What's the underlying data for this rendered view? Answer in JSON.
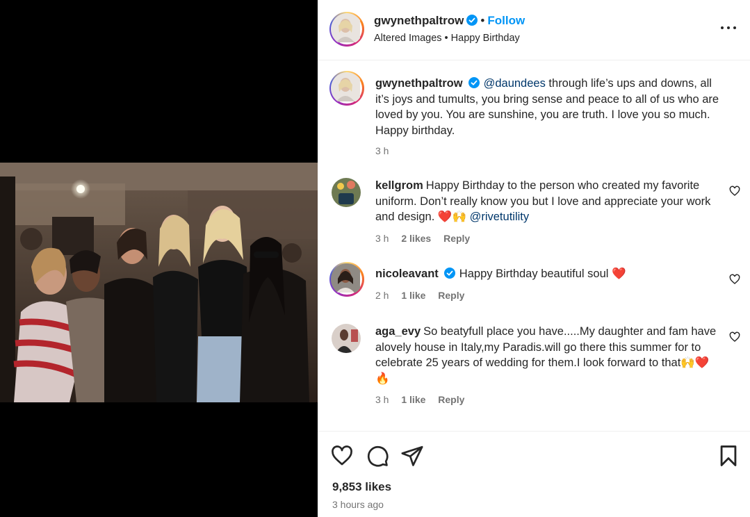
{
  "header": {
    "username": "gwynethpaltrow",
    "dot": "•",
    "follow_label": "Follow",
    "subtitle": "Altered Images • Happy Birthday",
    "more_icon": "more-horizontal-icon"
  },
  "caption": {
    "username": "gwynethpaltrow",
    "mention": "@daundees",
    "text": " through life’s ups and downs, all it’s joys and tumults, you bring sense and peace to all of us who are loved by you. You are sunshine, you are truth. I love you so much. Happy birthday.",
    "time": "3 h"
  },
  "comments": [
    {
      "username": "kellgrom",
      "text": "Happy Birthday to the person who created my favorite uniform. Don’t really know you but I love and appreciate your work and design. ",
      "emoji": "❤️🙌",
      "mention": "@rivetutility",
      "time": "3 h",
      "likes": "2 likes",
      "reply": "Reply"
    },
    {
      "username": "nicoleavant",
      "text": "Happy Birthday beautiful soul ",
      "emoji": "❤️",
      "time": "2 h",
      "likes": "1 like",
      "reply": "Reply"
    },
    {
      "username": "aga_evy",
      "text": "So beatyfull place you have.....My daughter and fam have alovely house in Italy,my Paradis.will go there this summer for to celebrate 25 years of wedding for them.I look forward to that",
      "emoji": "🙌❤️🔥",
      "time": "3 h",
      "likes": "1 like",
      "reply": "Reply"
    }
  ],
  "footer": {
    "likes": "9,853 likes",
    "time_ago": "3 hours ago"
  },
  "colors": {
    "link": "#00376b",
    "follow": "#0095f6",
    "verified": "#0095f6",
    "secondary_text": "#737373"
  }
}
